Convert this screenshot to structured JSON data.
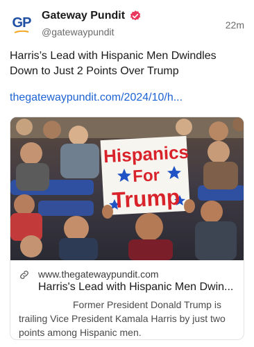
{
  "author": {
    "display_name": "Gateway Pundit",
    "handle": "@gatewaypundit",
    "avatar_text": "GP",
    "time_ago": "22m"
  },
  "post": {
    "text": "Harris’s Lead with Hispanic Men Dwindles Down to Just 2 Points Over Trump",
    "link_text": "thegatewaypundit.com/2024/10/h..."
  },
  "card": {
    "sign_lines": [
      "Hispanics",
      "For",
      "Trump"
    ],
    "domain": "www.thegatewaypundit.com",
    "title": "Harris's Lead with Hispanic Men Dwin...",
    "description": "Former President Donald Trump is trailing Vice President Kamala Harris by just two points among Hispanic men."
  },
  "colors": {
    "link": "#1d63d4",
    "verified_badge": "#e8365d",
    "brand_blue": "#1f4fa3",
    "sign_text": "#d8232a",
    "sign_stars": "#1f52c4"
  }
}
